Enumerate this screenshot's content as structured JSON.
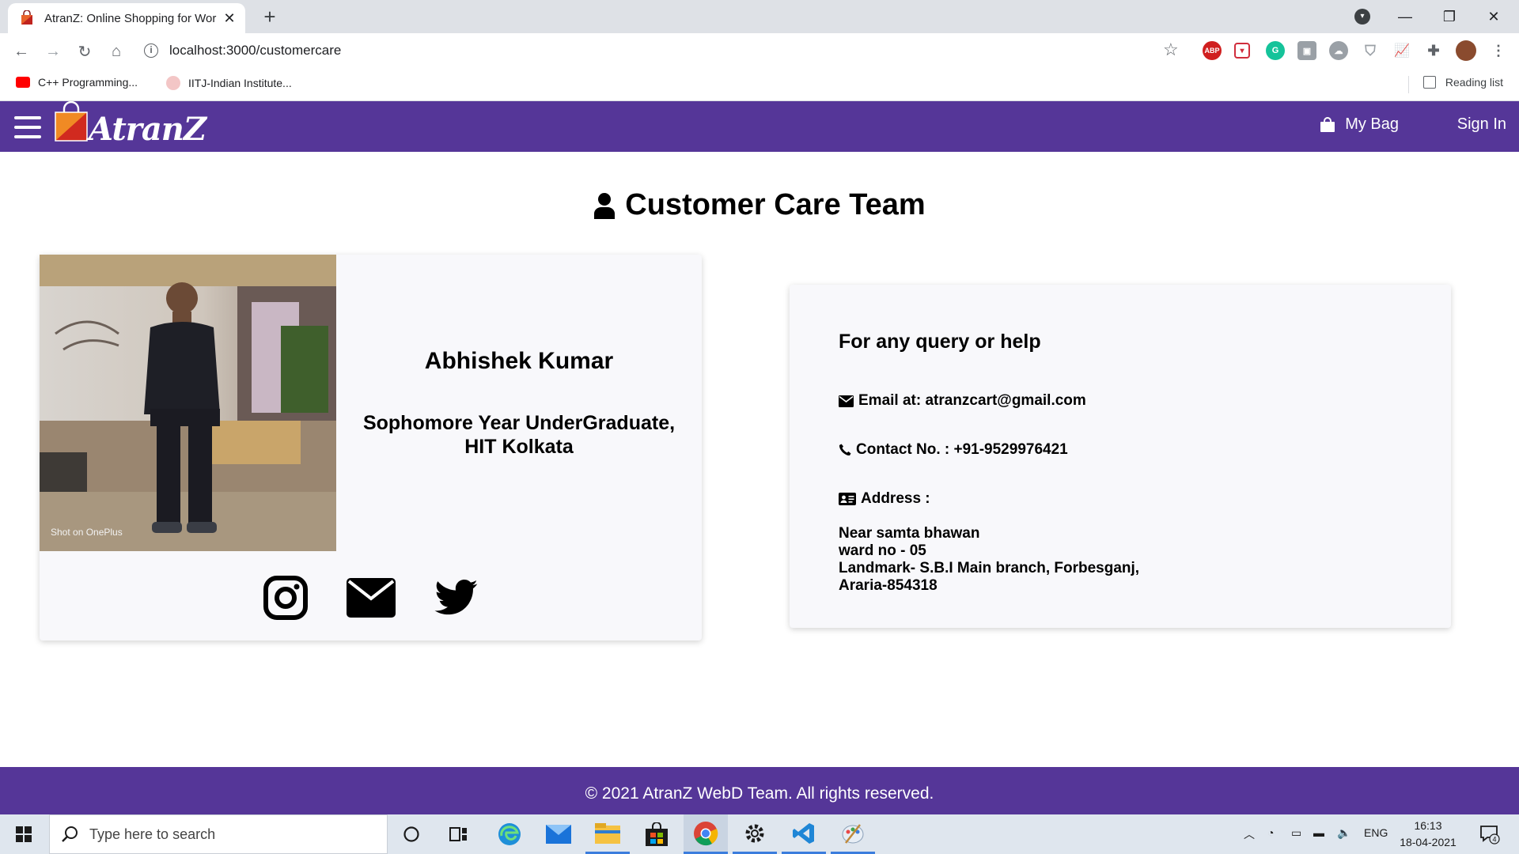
{
  "browser": {
    "tab_title": "AtranZ: Online Shopping for Wor",
    "url": "localhost:3000/customercare",
    "bookmarks": [
      "C++ Programming...",
      "IITJ-Indian Institute..."
    ],
    "reading_list_label": "Reading list",
    "extensions": [
      "abp-icon",
      "pocket-icon",
      "grammarly-icon",
      "extension-icon",
      "cloud-icon",
      "shield-icon",
      "chart-icon",
      "puzzle-icon"
    ]
  },
  "nav": {
    "logo_text": "AtranZ",
    "bag_label": "My Bag",
    "signin_label": "Sign In"
  },
  "page": {
    "title": "Customer Care Team"
  },
  "member": {
    "name": "Abhishek Kumar",
    "role_line1": "Sophomore Year UnderGraduate,",
    "role_line2": "HIT Kolkata",
    "photo_caption": "Shot on OnePlus"
  },
  "contact": {
    "heading": "For any query or help",
    "email": "Email at: atranzcart@gmail.com",
    "phone": "Contact No. : +91-9529976421",
    "address_label": "Address :",
    "address_lines": [
      "Near samta bhawan",
      "ward no - 05",
      "Landmark- S.B.I Main branch, Forbesganj,",
      "Araria-854318"
    ]
  },
  "footer": {
    "text": "© 2021 AtranZ WebD Team. All rights reserved."
  },
  "taskbar": {
    "search_placeholder": "Type here to search",
    "language": "ENG",
    "time": "16:13",
    "date": "18-04-2021",
    "notification_count": "4"
  },
  "colors": {
    "brand_purple": "#553698",
    "tabbar_gray": "#dee1e6",
    "card_bg": "#f8f8fb"
  }
}
